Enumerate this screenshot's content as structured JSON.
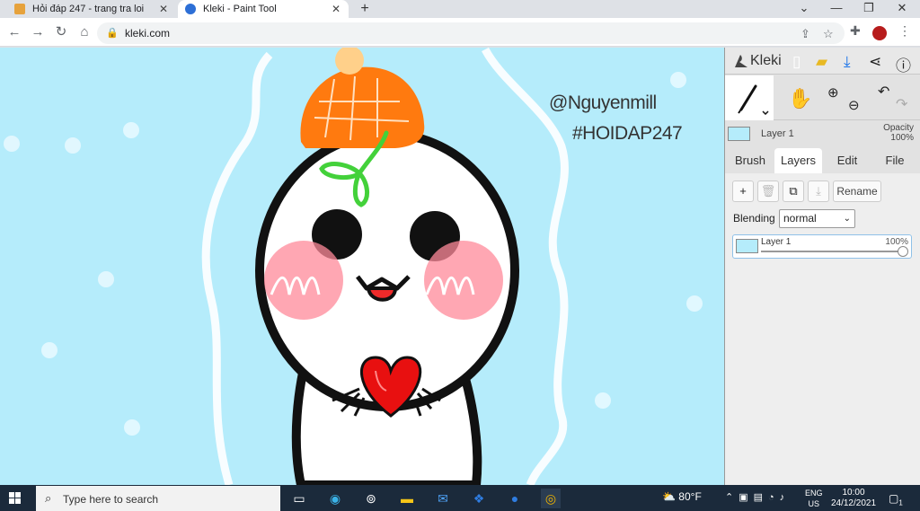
{
  "browser": {
    "tabs": [
      {
        "title": "Hỏi đáp 247 - trang tra loi",
        "active": false,
        "favicon_color": "#e6a23c"
      },
      {
        "title": "Kleki - Paint Tool",
        "active": true,
        "favicon_color": "#2d6fd6"
      }
    ],
    "new_tab": "+",
    "window_controls": {
      "minimize": "⌄",
      "min": "—",
      "restore": "❐",
      "close": "✕"
    },
    "nav": {
      "back": "←",
      "forward": "→",
      "reload": "↻",
      "home": "⌂"
    },
    "url": "kleki.com",
    "lock_icon": "🔒"
  },
  "canvas": {
    "background": "#b5ecfb",
    "watermark_line1": "@Nguyenmill",
    "watermark_line2": "#HOIDAP247"
  },
  "kleki": {
    "logo_text": "Kleki",
    "layer_name": "Layer 1",
    "opacity_label": "Opacity",
    "opacity_value": "100%",
    "tabs": [
      "Brush",
      "Layers",
      "Edit",
      "File"
    ],
    "active_tab": "Layers",
    "buttons": {
      "add": "+",
      "delete": "🗑",
      "duplicate": "⧉",
      "merge": "⤓",
      "rename": "Rename"
    },
    "blending_label": "Blending",
    "blending_value": "normal",
    "layer_item": {
      "name": "Layer 1",
      "opacity": "100%"
    }
  },
  "taskbar": {
    "search_placeholder": "Type here to search",
    "weather_temp": "80°F",
    "lang_line1": "ENG",
    "lang_line2": "US",
    "time": "10:00",
    "date": "24/12/2021",
    "notification_count": "1"
  }
}
